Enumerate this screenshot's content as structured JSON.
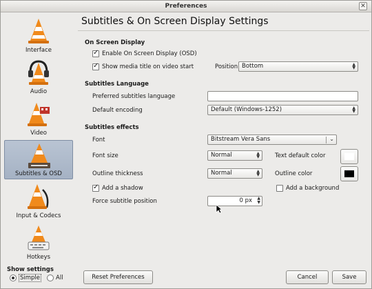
{
  "window": {
    "title": "Preferences"
  },
  "sidebar": {
    "items": [
      {
        "label": "Interface",
        "icon": "cone-icon"
      },
      {
        "label": "Audio",
        "icon": "headphones-cone-icon"
      },
      {
        "label": "Video",
        "icon": "film-cone-icon"
      },
      {
        "label": "Subtitles & OSD",
        "icon": "subtitles-cone-icon",
        "selected": true
      },
      {
        "label": "Input & Codecs",
        "icon": "cable-cone-icon"
      },
      {
        "label": "Hotkeys",
        "icon": "keyboard-cone-icon"
      }
    ]
  },
  "show_settings": {
    "label": "Show settings",
    "simple": "Simple",
    "all": "All",
    "selected": "Simple"
  },
  "main": {
    "title": "Subtitles & On Screen Display Settings",
    "osd": {
      "heading": "On Screen Display",
      "enable_osd": "Enable On Screen Display (OSD)",
      "show_media_title": "Show media title on video start",
      "position_label": "Position",
      "position_value": "Bottom"
    },
    "language": {
      "heading": "Subtitles Language",
      "preferred_label": "Preferred subtitles language",
      "preferred_value": "",
      "encoding_label": "Default encoding",
      "encoding_value": "Default (Windows-1252)"
    },
    "effects": {
      "heading": "Subtitles effects",
      "font_label": "Font",
      "font_value": "Bitstream Vera Sans",
      "font_size_label": "Font size",
      "font_size_value": "Normal",
      "text_color_label": "Text default color",
      "text_color": "#ffffff",
      "outline_thickness_label": "Outline thickness",
      "outline_thickness_value": "Normal",
      "outline_color_label": "Outline color",
      "outline_color": "#000000",
      "add_shadow": "Add a shadow",
      "add_background": "Add a background",
      "force_position_label": "Force subtitle position",
      "force_position_value": "0 px"
    }
  },
  "footer": {
    "reset": "Reset Preferences",
    "cancel": "Cancel",
    "save": "Save"
  }
}
